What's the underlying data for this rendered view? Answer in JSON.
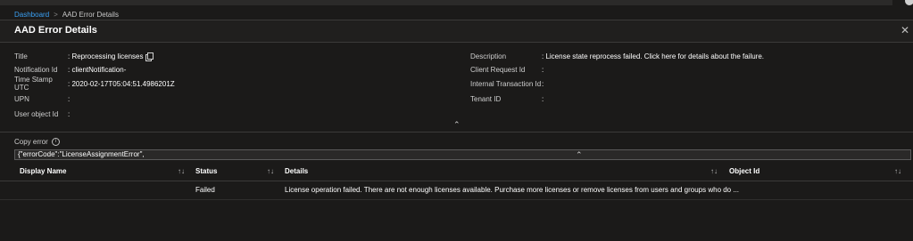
{
  "breadcrumb": {
    "root": "Dashboard",
    "separator": ">",
    "current": "AAD Error Details"
  },
  "panel": {
    "title": "AAD Error Details",
    "close_icon": "close-icon"
  },
  "left_fields": [
    {
      "label": "Title",
      "value": ": Reprocessing licenses"
    },
    {
      "label": "Notification Id",
      "value": ": clientNotification-"
    },
    {
      "label": "Time Stamp UTC",
      "value": ": 2020-02-17T05:04:51.4986201Z"
    },
    {
      "label": "UPN",
      "value": ":"
    },
    {
      "label": "User object Id",
      "value": ":"
    }
  ],
  "right_fields": [
    {
      "label": "Description",
      "value": ": License state reprocess failed. Click here for details about the failure."
    },
    {
      "label": "Client Request Id",
      "value": ":"
    },
    {
      "label": "Internal Transaction Id",
      "value": ":"
    },
    {
      "label": "Tenant ID",
      "value": ":"
    }
  ],
  "collapse_glyph": "⌃",
  "copy_error": {
    "label": "Copy error",
    "info_glyph": "i"
  },
  "json_value": "{\"errorCode\":\"LicenseAssignmentError\",",
  "table": {
    "sort_glyph": "↑↓",
    "columns": [
      "Display Name",
      "Status",
      "Details",
      "Object Id"
    ],
    "rows": [
      {
        "display_name": "",
        "status": "Failed",
        "details": "License operation failed. There are not enough licenses available. Purchase more licenses or remove licenses from users and groups who do ...",
        "object_id": ""
      }
    ]
  }
}
